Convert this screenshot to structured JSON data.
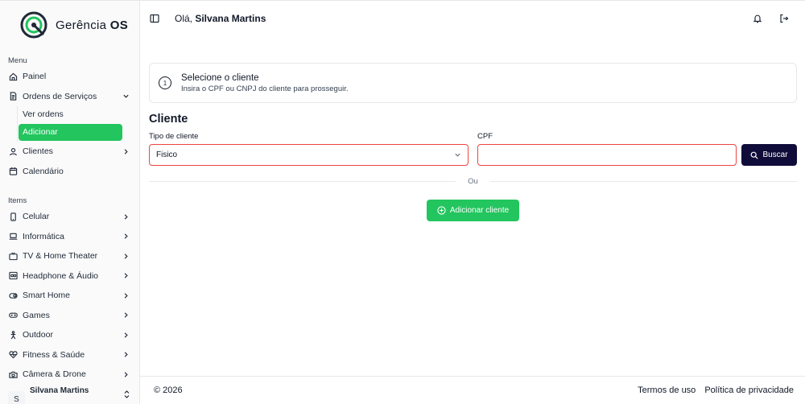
{
  "brand": {
    "name_regular": "Gerência ",
    "name_bold": "OS",
    "color": "#22c55e"
  },
  "sidebar": {
    "menu_label": "Menu",
    "items_label": "Items",
    "menu": [
      {
        "label": "Painel",
        "icon": "home-icon"
      },
      {
        "label": "Ordens de Serviços",
        "icon": "document-icon",
        "expanded": true,
        "children": [
          {
            "label": "Ver ordens",
            "active": false
          },
          {
            "label": "Adicionar",
            "active": true
          }
        ]
      },
      {
        "label": "Clientes",
        "icon": "user-icon"
      },
      {
        "label": "Calendário",
        "icon": "calendar-icon"
      }
    ],
    "items": [
      {
        "label": "Celular",
        "icon": "phone-icon"
      },
      {
        "label": "Informática",
        "icon": "laptop-icon"
      },
      {
        "label": "TV & Home Theater",
        "icon": "tv-icon"
      },
      {
        "label": "Headphone & Áudio",
        "icon": "headphone-icon"
      },
      {
        "label": "Smart Home",
        "icon": "smart-home-icon"
      },
      {
        "label": "Games",
        "icon": "gamepad-icon"
      },
      {
        "label": "Outdoor",
        "icon": "outdoor-icon"
      },
      {
        "label": "Fitness & Saúde",
        "icon": "heart-pulse-icon"
      },
      {
        "label": "Câmera & Drone",
        "icon": "camera-icon"
      }
    ],
    "user": {
      "initial": "S",
      "name": "Silvana Martins"
    }
  },
  "header": {
    "greeting": "Olá, ",
    "user_name": "Silvana Martins"
  },
  "step": {
    "number": "1",
    "title": "Selecione o cliente",
    "description": "Insira o CPF ou CNPJ do cliente para prosseguir."
  },
  "form": {
    "heading": "Cliente",
    "client_type_label": "Tipo de cliente",
    "client_type_value": "Fisico",
    "cpf_label": "CPF",
    "cpf_value": "",
    "search_label": "Buscar",
    "divider_text": "Ou",
    "add_client_label": "Adicionar cliente"
  },
  "footer": {
    "copyright": "© 2026",
    "terms": "Termos de uso",
    "privacy": "Política de privacidade"
  },
  "colors": {
    "primary_dark": "#0f0c3a",
    "accent_green": "#22c55e",
    "error_border": "#ef4444"
  }
}
